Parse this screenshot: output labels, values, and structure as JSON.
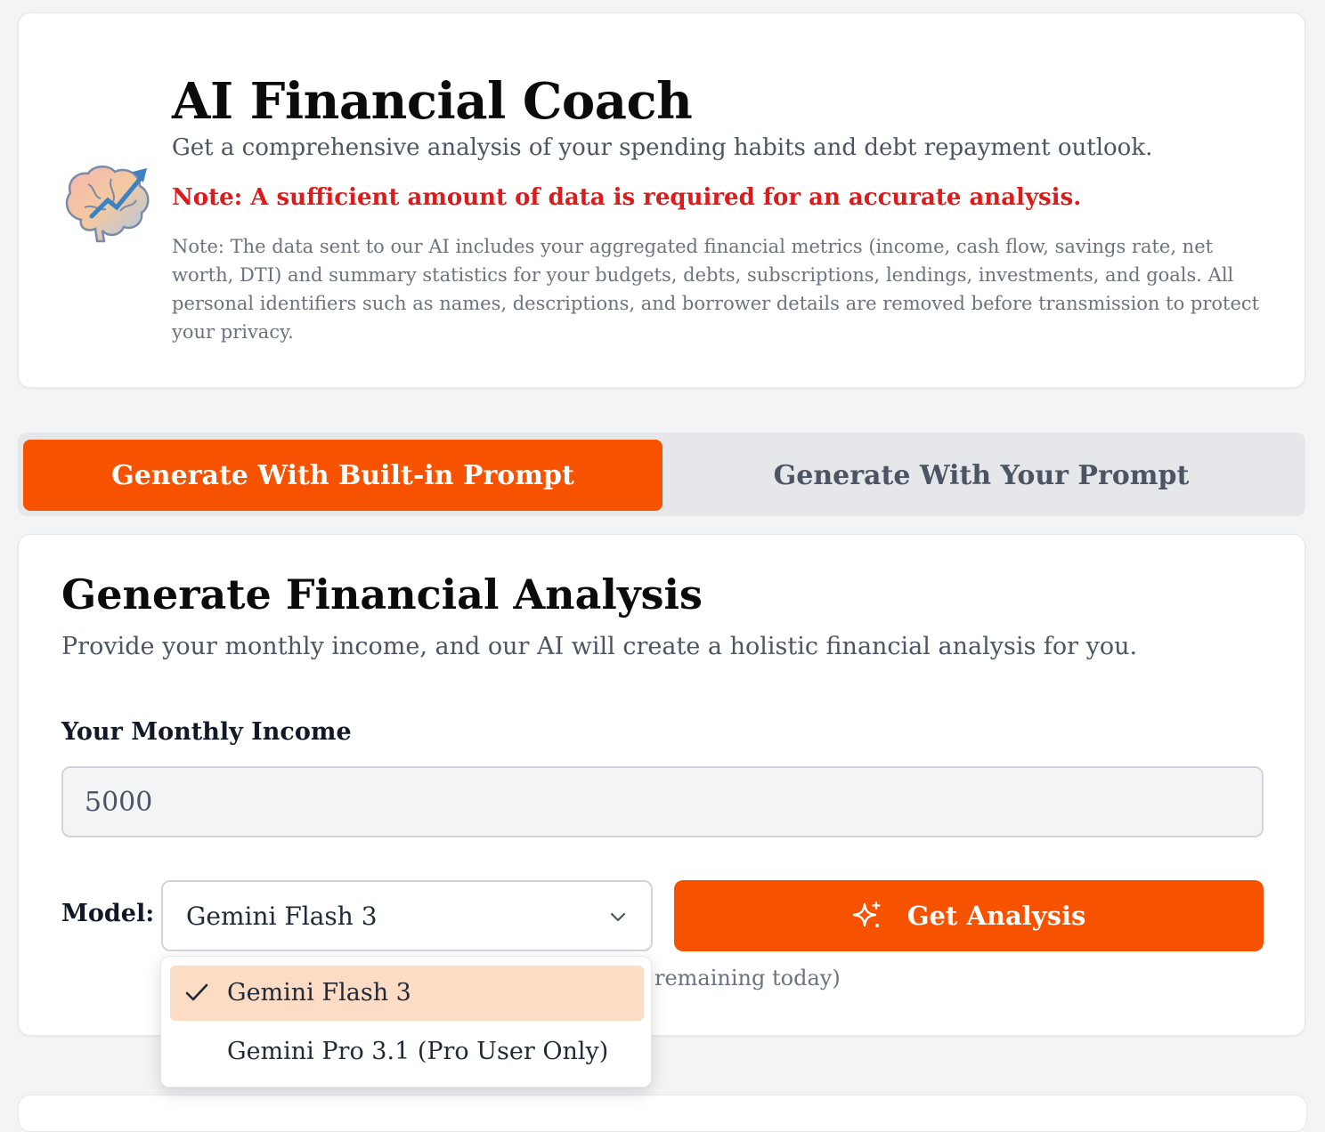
{
  "header": {
    "title": "AI Financial Coach",
    "subtitle": "Get a comprehensive analysis of your spending habits and debt repayment outlook.",
    "warning": "Note: A sufficient amount of data is required for an accurate analysis.",
    "privacy_note": "Note: The data sent to our AI includes your aggregated financial metrics (income, cash flow, savings rate, net worth, DTI) and summary statistics for your budgets, debts, subscriptions, lendings, investments, and goals. All personal identifiers such as names, descriptions, and borrower details are removed before transmission to protect your privacy.",
    "icon": "brain-icon"
  },
  "tabs": [
    {
      "label": "Generate With Built-in Prompt",
      "active": true
    },
    {
      "label": "Generate With Your Prompt",
      "active": false
    }
  ],
  "analysis": {
    "title": "Generate Financial Analysis",
    "description": "Provide your monthly income, and our AI will create a holistic financial analysis for you.",
    "income_label": "Your Monthly Income",
    "income_value": "5000",
    "model_label": "Model:",
    "model_selected": "Gemini Flash 3",
    "button_label": "Get Analysis",
    "remaining_note": "remaining today)"
  },
  "dropdown": {
    "options": [
      {
        "label": "Gemini Flash 3",
        "selected": true
      },
      {
        "label": "Gemini Pro 3.1 (Pro User Only)",
        "selected": false
      }
    ]
  },
  "colors": {
    "accent": "#f75200",
    "warning": "#dc1c1c",
    "selected_option_bg": "#fddcc6"
  }
}
